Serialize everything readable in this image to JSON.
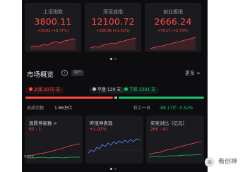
{
  "indices": [
    {
      "name": "上证指数",
      "value": "3800.11",
      "change": "+39.02 (+0.77%)"
    },
    {
      "name": "深证成指",
      "value": "12100.72",
      "change": "+180.36 (+1.32%)"
    },
    {
      "name": "创业板指",
      "value": "2666.24",
      "change": "+79.17 (+2.73%)"
    }
  ],
  "overview": {
    "title": "市场概览",
    "tag": "展开",
    "more": "更多 >",
    "up": "上涨 2075 支",
    "flat": "平盘 129 支",
    "down": "下跌 3291 支",
    "turnover_label": "总成交额",
    "turnover_value": "1.66万亿",
    "compare_label": "较上一日",
    "compare_value": "-88.17亿  -0.52%"
  },
  "mini_cards": [
    {
      "title": "涨跌停家数 >",
      "value": "62 : 1"
    },
    {
      "title": "昨涨停表现",
      "value": "+1.91%"
    },
    {
      "title": "买卖对比（亿元）",
      "value": "260 : 41"
    }
  ],
  "bottom_left_text": "数据来源",
  "watermark": "看创神",
  "colors": {
    "up": "#ff4a4a",
    "down": "#19c46a",
    "background": "#0d0d0f",
    "card": "#1b1b1f"
  }
}
